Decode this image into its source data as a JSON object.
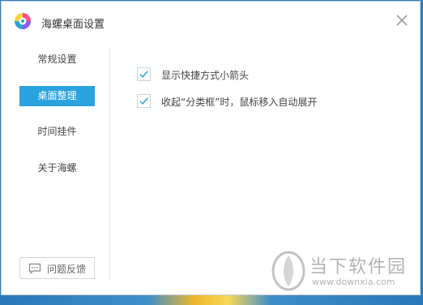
{
  "app": {
    "title": "海螺桌面设置"
  },
  "sidebar": {
    "items": [
      {
        "label": "常规设置",
        "active": false
      },
      {
        "label": "桌面整理",
        "active": true
      },
      {
        "label": "时间挂件",
        "active": false
      },
      {
        "label": "关于海螺",
        "active": false
      }
    ],
    "feedback_label": "问题反馈"
  },
  "options": [
    {
      "label": "显示快捷方式小箭头",
      "checked": true
    },
    {
      "label": "收起“分类框”时，鼠标移入自动展开",
      "checked": true
    }
  ],
  "watermark": {
    "name": "当下软件园",
    "url": "www.downxia.com"
  },
  "colors": {
    "accent": "#2aa3df",
    "window_bg": "#ffffff",
    "desktop": "#2f7fbf"
  }
}
